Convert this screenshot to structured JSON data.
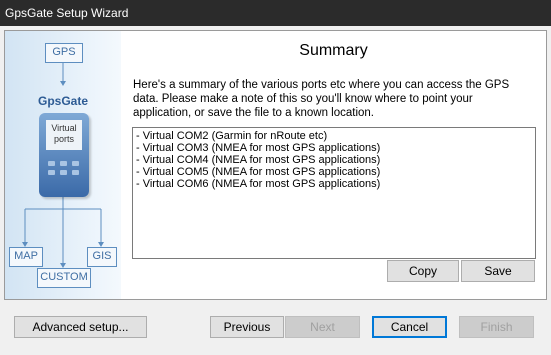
{
  "window": {
    "title": "GpsGate Setup Wizard"
  },
  "sidebar": {
    "gps_label": "GPS",
    "brand": "GpsGate",
    "device_label": "Virtual ports",
    "map_label": "MAP",
    "gis_label": "GIS",
    "custom_label": "CUSTOM"
  },
  "page": {
    "heading": "Summary",
    "description": "Here's a summary of the various ports etc where you can access the GPS data. Please make a note of this so you'll know where to point your application, or save the file to a known location.",
    "ports": [
      "- Virtual COM2 (Garmin for nRoute etc)",
      "- Virtual COM3 (NMEA for most GPS applications)",
      "- Virtual COM4 (NMEA for most GPS applications)",
      "- Virtual COM5 (NMEA for most GPS applications)",
      "- Virtual COM6 (NMEA for most GPS applications)"
    ],
    "copy_label": "Copy",
    "save_label": "Save"
  },
  "footer": {
    "advanced_label": "Advanced setup...",
    "previous_label": "Previous",
    "next_label": "Next",
    "cancel_label": "Cancel",
    "finish_label": "Finish"
  }
}
